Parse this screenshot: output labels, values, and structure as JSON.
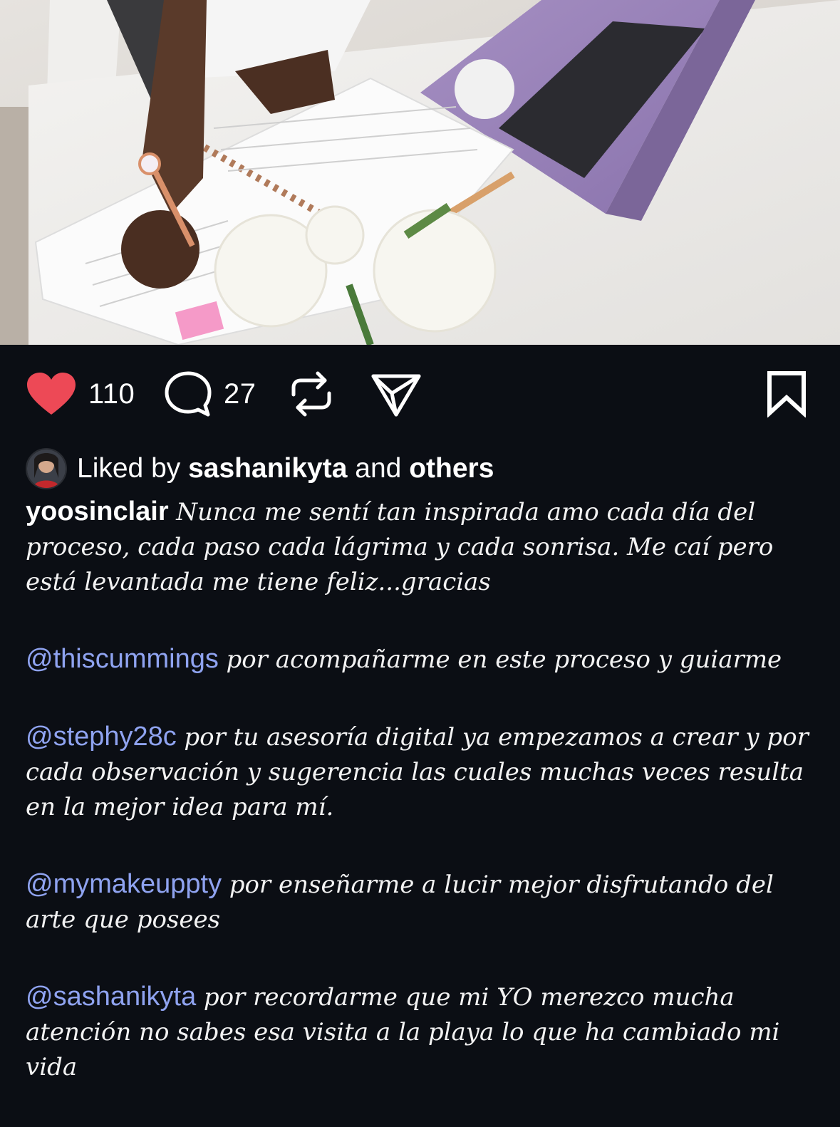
{
  "post": {
    "image_alt": "Woman writing in a spiral notebook next to a purple laptop and white flowers",
    "actions": {
      "like_count": "110",
      "comment_count": "27",
      "liked": true,
      "like_color": "#ed4956"
    },
    "likes": {
      "prefix": "Liked by",
      "user": "sashanikyta",
      "middle": "and",
      "others": "others"
    },
    "caption": {
      "author": "yoosinclair",
      "intro": "Nunca me sentí tan inspirada amo cada día del proceso, cada paso cada lágrima y cada sonrisa. Me caí pero está levantada me tiene feliz...gracias",
      "thanks": [
        {
          "mention": "@thiscummings",
          "text": "por acompañarme en este proceso y guiarme"
        },
        {
          "mention": "@stephy28c",
          "text": "por tu asesoría digital ya empezamos a crear y por cada observación y sugerencia las cuales muchas veces resulta en la mejor idea para mí."
        },
        {
          "mention": "@mymakeuppty",
          "text": "por enseñarme a lucir mejor disfrutando del arte que posees"
        },
        {
          "mention": "@sashanikyta",
          "text": "por recordarme que mi YO merezco mucha atención no sabes esa visita a la playa lo que ha cambiado mi vida"
        }
      ]
    },
    "colors": {
      "background": "#0b0e14",
      "mention": "#8fa3f0",
      "text": "#ffffff"
    }
  }
}
